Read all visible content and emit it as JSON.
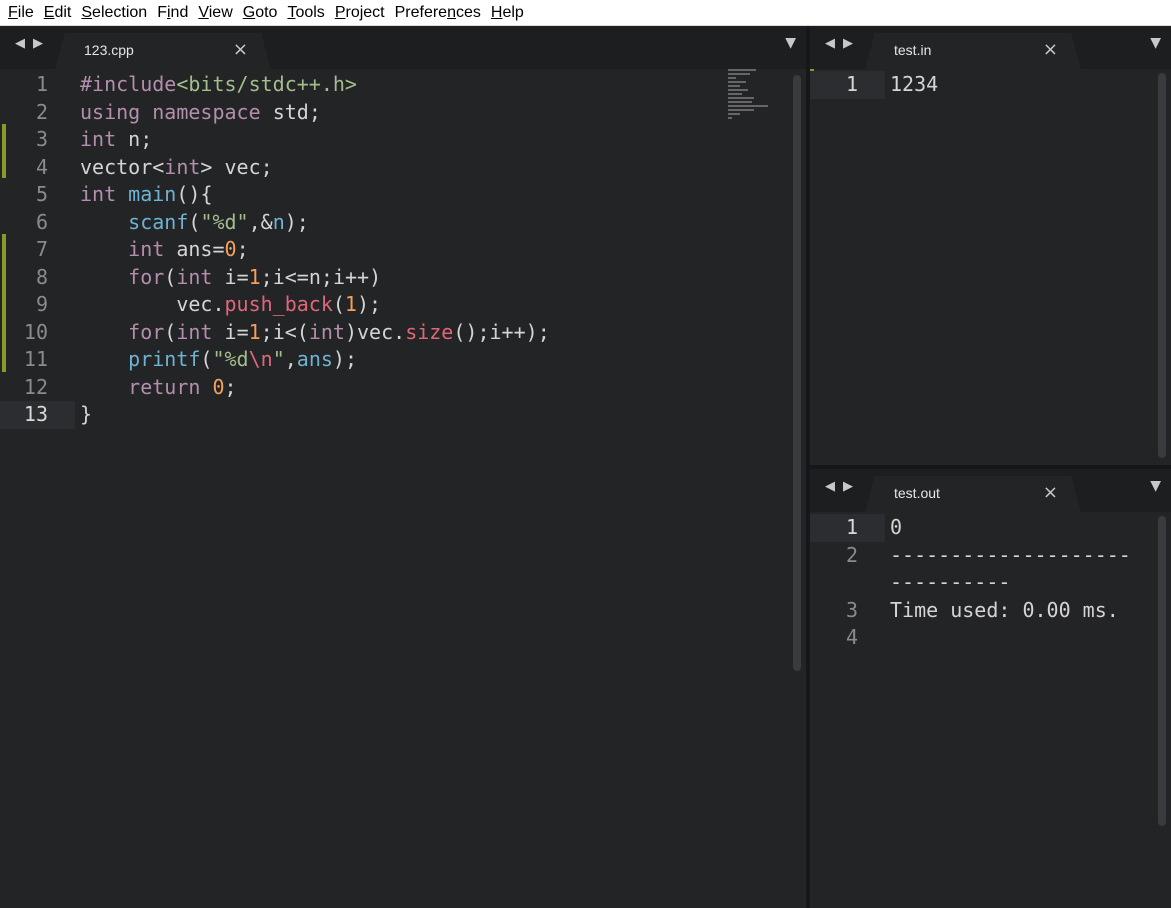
{
  "menu": [
    "File",
    "Edit",
    "Selection",
    "Find",
    "View",
    "Goto",
    "Tools",
    "Project",
    "Preferences",
    "Help"
  ],
  "menu_underline": [
    "F",
    "E",
    "S",
    "i",
    "V",
    "G",
    "T",
    "P",
    "n",
    "H"
  ],
  "left_pane": {
    "tab_label": "123.cpp",
    "nav_back": "◀",
    "nav_forward": "▶",
    "close": "×",
    "dropdown": "▼",
    "lines": [
      {
        "n": "1",
        "code": "#include<bits/stdc++.h>"
      },
      {
        "n": "2",
        "code": "using namespace std;"
      },
      {
        "n": "3",
        "code": "int n;"
      },
      {
        "n": "4",
        "code": "vector<int> vec;"
      },
      {
        "n": "5",
        "code": "int main(){"
      },
      {
        "n": "6",
        "code": "    scanf(\"%d\",&n);"
      },
      {
        "n": "7",
        "code": "    int ans=0;"
      },
      {
        "n": "8",
        "code": "    for(int i=1;i<=n;i++)"
      },
      {
        "n": "9",
        "code": "        vec.push_back(1);"
      },
      {
        "n": "10",
        "code": "    for(int i=1;i<(int)vec.size();i++);"
      },
      {
        "n": "11",
        "code": "    printf(\"%d\\n\",ans);"
      },
      {
        "n": "12",
        "code": "    return 0;"
      },
      {
        "n": "13",
        "code": "}"
      }
    ]
  },
  "top_right_pane": {
    "tab_label": "test.in",
    "nav_back": "◀",
    "nav_forward": "▶",
    "close": "×",
    "dropdown": "▼",
    "lines": [
      {
        "n": "1",
        "code": "1234"
      }
    ]
  },
  "bottom_right_pane": {
    "tab_label": "test.out",
    "nav_back": "◀",
    "nav_forward": "▶",
    "close": "×",
    "dropdown": "▼",
    "lines": [
      {
        "n": "1",
        "code": "0"
      },
      {
        "n": "2",
        "code": "--------------------"
      },
      {
        "n": "",
        "code": "----------"
      },
      {
        "n": "3",
        "code": "Time used: 0.00 ms."
      },
      {
        "n": "4",
        "code": ""
      }
    ]
  },
  "colors": {
    "background": "#232426",
    "keyword": "#b48ead",
    "function": "#6fb3d2",
    "string": "#a3be8c",
    "number": "#f59f5c",
    "modified_marker": "#8a9a2a"
  }
}
